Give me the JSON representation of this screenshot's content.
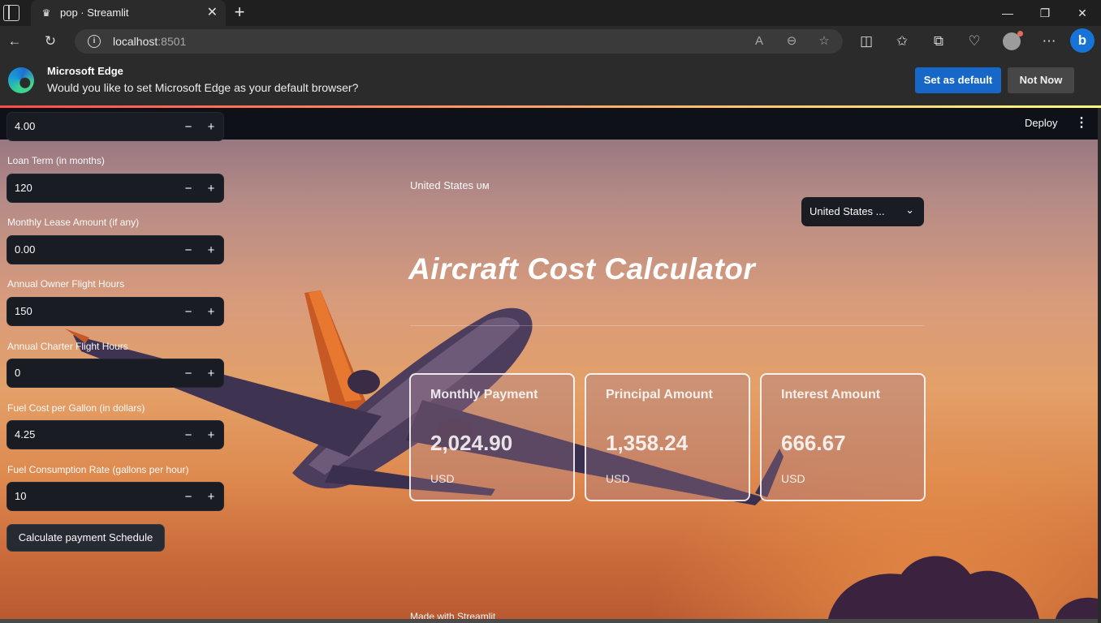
{
  "browser": {
    "tab_title": "pop · Streamlit",
    "url_host": "localhost",
    "url_port": ":8501",
    "infobar": {
      "title": "Microsoft Edge",
      "message": "Would you like to set Microsoft Edge as your default browser?",
      "set_default": "Set as default",
      "not_now": "Not Now"
    }
  },
  "header": {
    "deploy": "Deploy"
  },
  "sidebar": {
    "fields": [
      {
        "label": "",
        "value": "4.00"
      },
      {
        "label": "Loan Term (in months)",
        "value": "120"
      },
      {
        "label": "Monthly Lease Amount (if any)",
        "value": "0.00"
      },
      {
        "label": "Annual Owner Flight Hours",
        "value": "150"
      },
      {
        "label": "Annual Charter Flight Hours",
        "value": "0"
      },
      {
        "label": "Fuel Cost per Gallon (in dollars)",
        "value": "4.25"
      },
      {
        "label": "Fuel Consumption Rate (gallons per hour)",
        "value": "10"
      }
    ],
    "calc_button": "Calculate payment Schedule"
  },
  "main": {
    "country_label": "United States ᴜᴍ",
    "country_select": "United States ...",
    "title": "Aircraft Cost Calculator",
    "cards": [
      {
        "title": "Monthly Payment",
        "value": "2,024.90",
        "unit": "USD"
      },
      {
        "title": "Principal Amount",
        "value": "1,358.24",
        "unit": "USD"
      },
      {
        "title": "Interest Amount",
        "value": "666.67",
        "unit": "USD"
      }
    ],
    "footer": "Made with Streamlit"
  }
}
